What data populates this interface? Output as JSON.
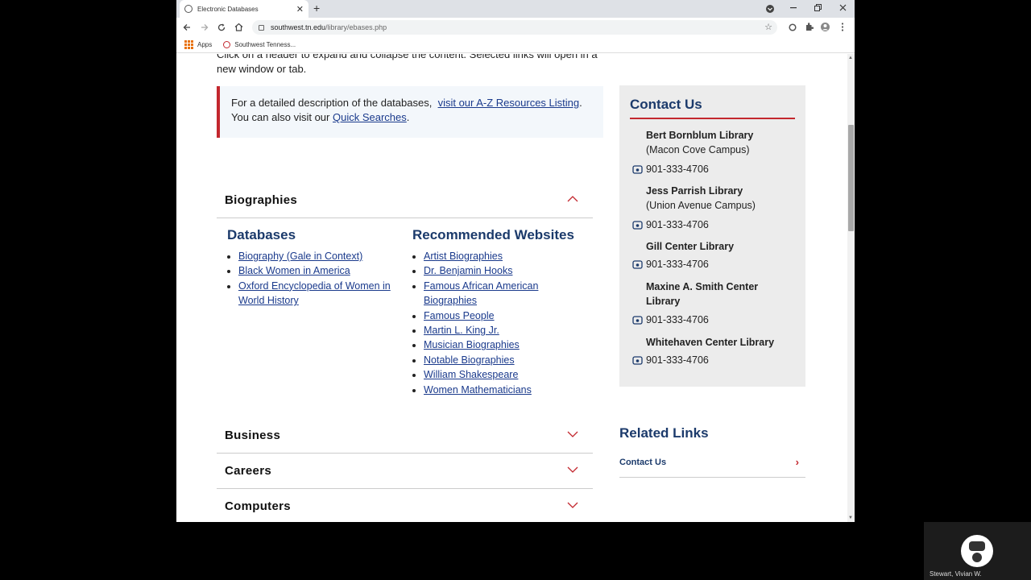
{
  "browser": {
    "tab_title": "Electronic Databases",
    "tab_close": "✕",
    "new_tab": "+",
    "url_host": "southwest.tn.edu",
    "url_path": "/library/ebases.php",
    "bookmarks": [
      "Apps",
      "Southwest Tenness..."
    ]
  },
  "page": {
    "intro": "Click on a header to expand and collapse the content. Selected links will open in a new window or tab.",
    "callout": {
      "text1": "For a detailed description of the databases,",
      "link1": "visit our A-Z Resources Listing",
      "text2": "You can also visit our",
      "link2": "Quick Searches"
    },
    "accordion": [
      {
        "label": "Biographies",
        "expanded": true
      },
      {
        "label": "Business",
        "expanded": false
      },
      {
        "label": "Careers",
        "expanded": false
      },
      {
        "label": "Computers",
        "expanded": false
      }
    ],
    "biographies": {
      "databases_title": "Databases",
      "databases": [
        "Biography (Gale in Context)",
        "Black Women in America",
        "Oxford Encyclopedia of Women in World History"
      ],
      "websites_title": "Recommended Websites",
      "websites": [
        "Artist Biographies",
        "Dr. Benjamin Hooks",
        "Famous African American Biographies",
        "Famous People",
        "Martin L. King Jr.",
        "Musician Biographies",
        "Notable Biographies",
        "William Shakespeare",
        "Women Mathematicians"
      ]
    },
    "contact": {
      "title": "Contact Us",
      "locations": [
        {
          "name": "Bert Bornblum Library",
          "campus": "(Macon Cove Campus)",
          "phone": "901-333-4706"
        },
        {
          "name": "Jess Parrish Library",
          "campus": "(Union Avenue Campus)",
          "phone": "901-333-4706"
        },
        {
          "name": "Gill Center Library",
          "campus": "",
          "phone": "901-333-4706"
        },
        {
          "name": "Maxine A. Smith Center Library",
          "campus": "",
          "phone": "901-333-4706"
        },
        {
          "name": "Whitehaven Center Library",
          "campus": "",
          "phone": "901-333-4706"
        }
      ]
    },
    "related": {
      "title": "Related Links",
      "link": "Contact Us"
    }
  },
  "webcam": {
    "name": "Stewart, Vivian W."
  },
  "colors": {
    "accent_red": "#c3272e",
    "navy": "#1b3a6b",
    "link": "#1a3a8c"
  }
}
